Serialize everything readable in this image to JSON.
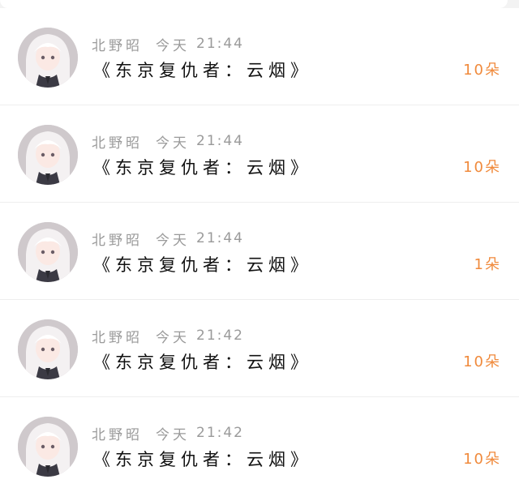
{
  "rows": [
    {
      "name": "北野昭",
      "day": "今天",
      "time": "21:44",
      "title": "《东京复仇者：云烟》",
      "gift": "10朵"
    },
    {
      "name": "北野昭",
      "day": "今天",
      "time": "21:44",
      "title": "《东京复仇者：云烟》",
      "gift": "10朵"
    },
    {
      "name": "北野昭",
      "day": "今天",
      "time": "21:44",
      "title": "《东京复仇者：云烟》",
      "gift": "1朵"
    },
    {
      "name": "北野昭",
      "day": "今天",
      "time": "21:42",
      "title": "《东京复仇者：云烟》",
      "gift": "10朵"
    },
    {
      "name": "北野昭",
      "day": "今天",
      "time": "21:42",
      "title": "《东京复仇者：云烟》",
      "gift": "10朵"
    }
  ],
  "colors": {
    "gift_accent": "#f08a3c",
    "meta_gray": "#9a9a9a",
    "title_black": "#111111"
  },
  "icons": {
    "avatar": "anime-girl-avatar-icon"
  }
}
